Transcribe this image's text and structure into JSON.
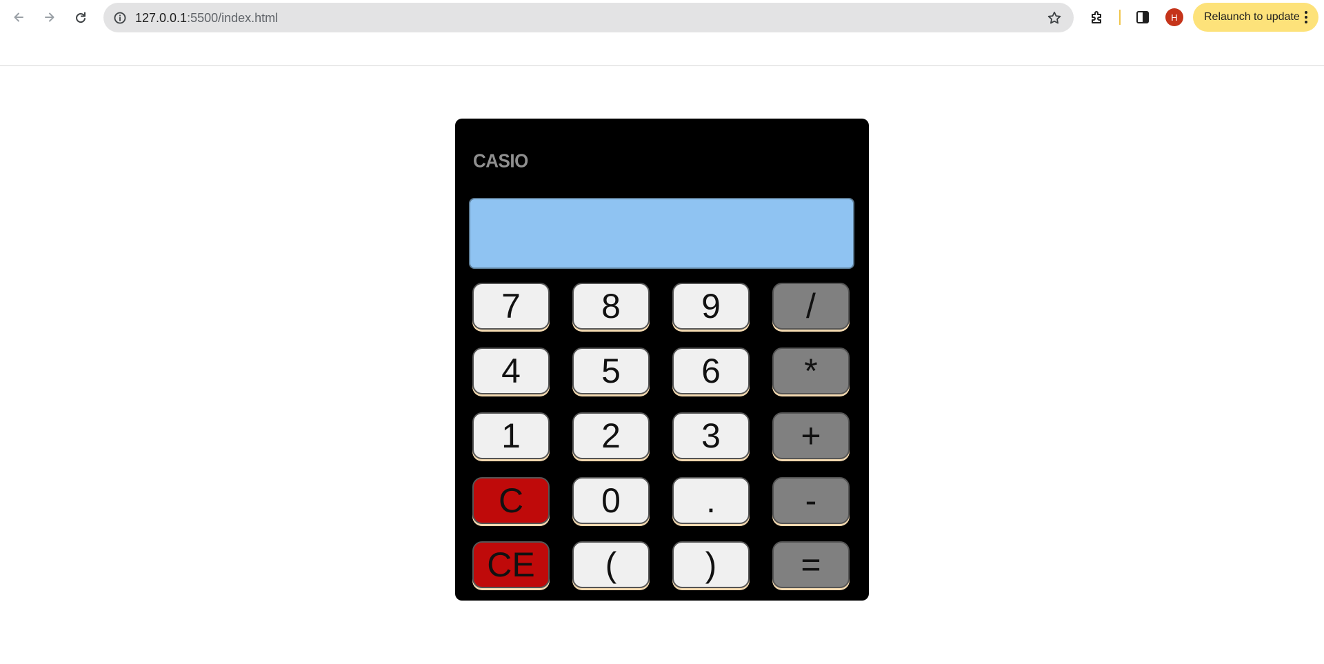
{
  "browser": {
    "url_host": "127.0.0.1",
    "url_path": ":5500/index.html",
    "relaunch_label": "Relaunch to update",
    "avatar_initial": "H",
    "colors": {
      "omnibox_bg": "#e3e3e4",
      "relaunch_bg": "#fde27a",
      "avatar_bg": "#c5341a"
    }
  },
  "calculator": {
    "brand": "CASIO",
    "display_value": "",
    "colors": {
      "body": "#000000",
      "display": "#8fc3f2",
      "number_key": "#f0f0f0",
      "operator_key": "#808080",
      "clear_key": "#bf0a0a"
    },
    "keys": [
      {
        "label": "7",
        "kind": "number"
      },
      {
        "label": "8",
        "kind": "number"
      },
      {
        "label": "9",
        "kind": "number"
      },
      {
        "label": "/",
        "kind": "operator"
      },
      {
        "label": "4",
        "kind": "number"
      },
      {
        "label": "5",
        "kind": "number"
      },
      {
        "label": "6",
        "kind": "number"
      },
      {
        "label": "*",
        "kind": "operator"
      },
      {
        "label": "1",
        "kind": "number"
      },
      {
        "label": "2",
        "kind": "number"
      },
      {
        "label": "3",
        "kind": "number"
      },
      {
        "label": "+",
        "kind": "operator"
      },
      {
        "label": "C",
        "kind": "clear"
      },
      {
        "label": "0",
        "kind": "number"
      },
      {
        "label": ".",
        "kind": "number"
      },
      {
        "label": "-",
        "kind": "operator"
      },
      {
        "label": "CE",
        "kind": "clear"
      },
      {
        "label": "(",
        "kind": "number"
      },
      {
        "label": ")",
        "kind": "number"
      },
      {
        "label": "=",
        "kind": "operator"
      }
    ]
  }
}
